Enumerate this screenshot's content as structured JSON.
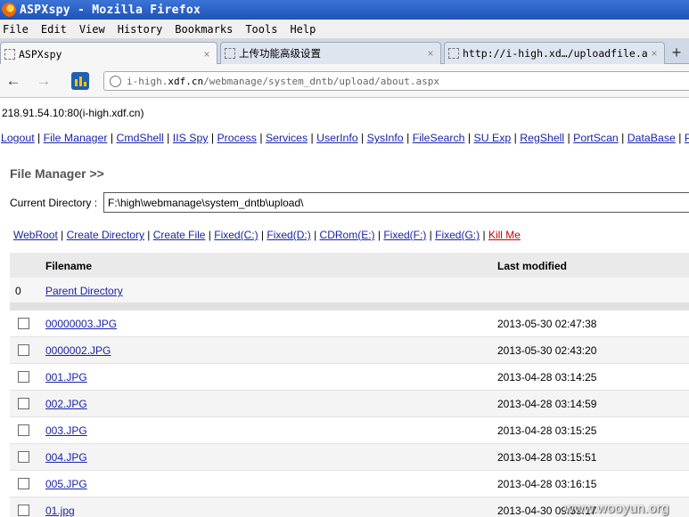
{
  "window": {
    "title": "ASPXspy - Mozilla Firefox"
  },
  "menu": [
    "File",
    "Edit",
    "View",
    "History",
    "Bookmarks",
    "Tools",
    "Help"
  ],
  "tabs": [
    {
      "label": "ASPXspy",
      "active": true
    },
    {
      "label": "上传功能高级设置",
      "active": false
    },
    {
      "label": "http://i-high.xd…/uploadfile.aspx",
      "active": false
    }
  ],
  "newtab": "+",
  "close_glyph": "×",
  "nav": {
    "url_prefix": "i-high.",
    "url_domain": "xdf.cn",
    "url_path": "/webmanage/system_dntb/upload/about.aspx"
  },
  "host": "218.91.54.10:80(i-high.xdf.cn)",
  "topnav": [
    "Logout",
    "File Manager",
    "CmdShell",
    "IIS Spy",
    "Process",
    "Services",
    "UserInfo",
    "SysInfo",
    "FileSearch",
    "SU Exp",
    "RegShell",
    "PortScan",
    "DataBase",
    "Port"
  ],
  "heading": "File Manager >>",
  "current_directory": {
    "label": "Current Directory :",
    "value": "F:\\high\\webmanage\\system_dntb\\upload\\"
  },
  "actions": [
    "WebRoot",
    "Create Directory",
    "Create File",
    "Fixed(C:)",
    "Fixed(D:)",
    "CDRom(E:)",
    "Fixed(F:)",
    "Fixed(G:)"
  ],
  "kill_label": "Kill Me",
  "table": {
    "col_filename": "Filename",
    "col_modified": "Last modified",
    "parent_index": "0",
    "parent_label": "Parent Directory",
    "rows": [
      {
        "name": "00000003.JPG",
        "modified": "2013-05-30 02:47:38"
      },
      {
        "name": "0000002.JPG",
        "modified": "2013-05-30 02:43:20"
      },
      {
        "name": "001.JPG",
        "modified": "2013-04-28 03:14:25"
      },
      {
        "name": "002.JPG",
        "modified": "2013-04-28 03:14:59"
      },
      {
        "name": "003.JPG",
        "modified": "2013-04-28 03:15:25"
      },
      {
        "name": "004.JPG",
        "modified": "2013-04-28 03:15:51"
      },
      {
        "name": "005.JPG",
        "modified": "2013-04-28 03:16:15"
      },
      {
        "name": "01.jpg",
        "modified": "2013-04-30 09:59:17"
      }
    ]
  },
  "watermark": "www.wooyun.org"
}
